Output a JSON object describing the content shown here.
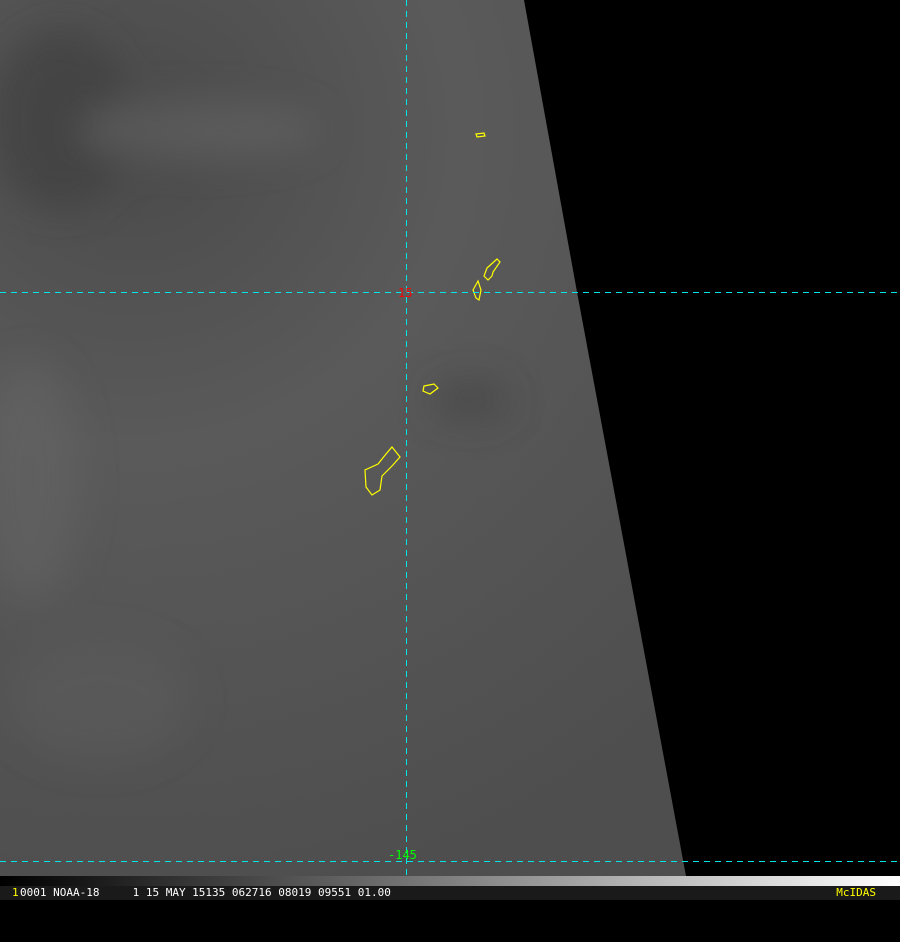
{
  "image": {
    "grid": {
      "lat_label": "15",
      "lon_label": "-145",
      "grid_color": "#00e5e5",
      "lat_label_color": "#ff0000",
      "lon_label_color": "#00ff00"
    },
    "coastline_color": "#ffff00"
  },
  "status_bar": {
    "frame_number": "1",
    "info": "0001 NOAA-18     1 15 MAY 15135 062716 08019 09551 01.00",
    "brand": "McIDAS"
  }
}
